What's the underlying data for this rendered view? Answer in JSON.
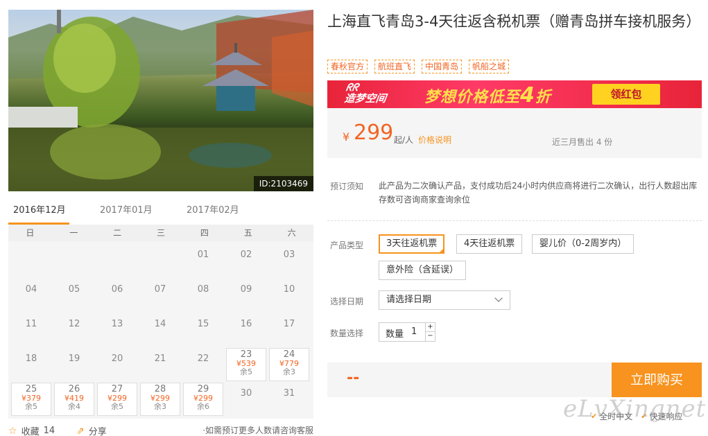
{
  "photo": {
    "id_label": "ID:2103469"
  },
  "calendar": {
    "months": [
      "2016年12月",
      "2017年01月",
      "2017年02月"
    ],
    "active_month": 0,
    "weekdays": [
      "日",
      "一",
      "二",
      "三",
      "四",
      "五",
      "六"
    ],
    "rows": [
      [
        null,
        null,
        null,
        null,
        {
          "d": "01"
        },
        {
          "d": "02"
        },
        {
          "d": "03"
        }
      ],
      [
        {
          "d": "04"
        },
        {
          "d": "05"
        },
        {
          "d": "06"
        },
        {
          "d": "07"
        },
        {
          "d": "08"
        },
        {
          "d": "09"
        },
        {
          "d": "10"
        }
      ],
      [
        {
          "d": "11"
        },
        {
          "d": "12"
        },
        {
          "d": "13"
        },
        {
          "d": "14"
        },
        {
          "d": "15"
        },
        {
          "d": "16"
        },
        {
          "d": "17"
        }
      ],
      [
        {
          "d": "18"
        },
        {
          "d": "19"
        },
        {
          "d": "20"
        },
        {
          "d": "21"
        },
        {
          "d": "22"
        },
        {
          "d": "23",
          "price": "¥539",
          "stock": "余5"
        },
        {
          "d": "24",
          "price": "¥779",
          "stock": "余3"
        }
      ],
      [
        {
          "d": "25",
          "price": "¥379",
          "stock": "余5"
        },
        {
          "d": "26",
          "price": "¥419",
          "stock": "余4"
        },
        {
          "d": "27",
          "price": "¥299",
          "stock": "余5"
        },
        {
          "d": "28",
          "price": "¥299",
          "stock": "余3"
        },
        {
          "d": "29",
          "price": "¥299",
          "stock": "余6"
        },
        {
          "d": "30"
        },
        {
          "d": "31"
        }
      ]
    ]
  },
  "actions": {
    "favorite_label": "收藏",
    "favorite_count": "14",
    "share_label": "分享",
    "note": "·如需预订更多人数请咨询客服"
  },
  "product": {
    "title": "上海直飞青岛3-4天往返含税机票（赠青岛拼车接机服务）",
    "tags": [
      "春秋官方",
      "航班直飞",
      "中国青岛",
      "帆船之城"
    ]
  },
  "banner": {
    "logo_line1": "ᖇᖇ",
    "logo_text": "造梦空间",
    "slogan_pre": "梦想价格低至",
    "slogan_num": "4",
    "slogan_post": "折",
    "button": "领红包"
  },
  "price": {
    "currency": "¥",
    "amount": "299",
    "unit": "起/人",
    "explain_link": "价格说明",
    "sold": "近三月售出 4 份"
  },
  "notice": {
    "label": "预订须知",
    "text": "此产品为二次确认产品，支付成功后24小时内供应商将进行二次确认，出行人数超出库存数可咨询商家查询余位"
  },
  "product_type": {
    "label": "产品类型",
    "options": [
      "3天往返机票",
      "4天往返机票",
      "婴儿价（0-2周岁内）",
      "意外险（含延误）"
    ],
    "selected": 0
  },
  "date_select": {
    "label": "选择日期",
    "value": "请选择日期"
  },
  "quantity": {
    "label": "数量选择",
    "inner_label": "数量",
    "value": "1",
    "plus": "+",
    "minus": "−"
  },
  "buy": {
    "total": "--",
    "button": "立即购买"
  },
  "features": [
    "全时中文",
    "快速响应"
  ],
  "watermark": "eLvXingnet",
  "colors": {
    "accent": "#f7931e",
    "price": "#f26522",
    "banner_red": "#e8243a"
  }
}
